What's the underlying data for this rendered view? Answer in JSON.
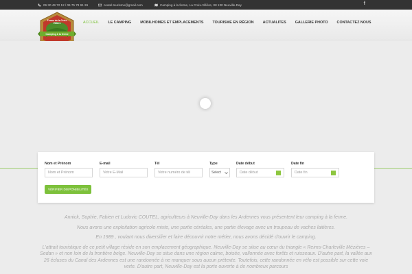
{
  "topbar": {
    "phone": "06 30 49 72 12 / 06 75 79 91 26",
    "email": "coutel.tourisme@gmail.com",
    "address": "Camping à la ferme, La Croix-Villière, 08 130 Neuville-Day",
    "facebook_glyph": "f"
  },
  "nav": {
    "items": [
      {
        "label": "ACCUEIL",
        "active": true
      },
      {
        "label": "LE CAMPING",
        "active": false
      },
      {
        "label": "MOBILHOMES ET EMPLACEMENTS",
        "active": false
      },
      {
        "label": "TOURISME EN RÉGION",
        "active": false
      },
      {
        "label": "ACTUALITES",
        "active": false
      },
      {
        "label": "GALLERIE PHOTO",
        "active": false
      },
      {
        "label": "CONTACTEZ NOUS",
        "active": false
      }
    ]
  },
  "logo": {
    "text_top": "Ferme de la Croix Villière",
    "text_ribbon": "Camping à la ferme"
  },
  "booking": {
    "name_label": "Nom et Prénom",
    "name_placeholder": "Nom et Prénom",
    "email_label": "E-mail",
    "email_placeholder": "Votre E-Mail",
    "tel_label": "Tél",
    "tel_placeholder": "Votre numéro de tél",
    "type_label": "Type",
    "type_value": "Select",
    "start_label": "Date début",
    "start_placeholder": "Date début",
    "end_label": "Date fin",
    "end_placeholder": "Date fin",
    "submit_label": "VÉRIFIER DISPONIBILITÉS"
  },
  "content": {
    "p1": "Annick, Sophie, Fabien et Ludovic COUTEL, agriculteurs à Neuville-Day dans les Ardennes vous présentent leur camping à la ferme.",
    "p2": "Nous avons une exploitation agricole mixte, une partie céréales, une partie élevage avec un troupeau de vaches laitières.",
    "p3": "En 1989 , voulant nous diversifier et faire découvrir notre métier, nous avons décidé d'ouvrir le camping.",
    "p4": "L'attrait touristique de ce petit village réside en son emplacement géographique. Neuville-Day se situe au cœur du triangle « Reims-Charleville Mézières – Sedan » et non loin de la frontière belge. Neuville-Day se situe dans une région calme, boisée, vallonnée avec forêts et ruisseaux. D'autre part, la vallée aux 26 écluses du Canal des Ardennes est une randonnée à ne manquer sous aucun prétexte. Toutefois, cette randonnée en vélo est possible sur cette voie verte. D'autre part, Neuville-Day est la porte ouverte à de nombreux parcours"
  },
  "colors": {
    "accent": "#7dc13b",
    "topbar": "#333333",
    "text_muted": "#aaaaaa"
  }
}
